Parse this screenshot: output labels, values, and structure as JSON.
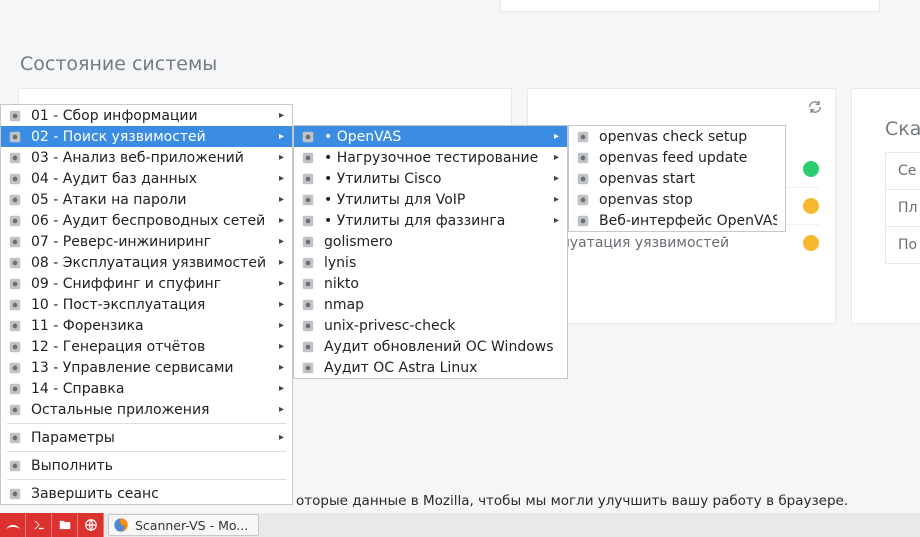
{
  "page": {
    "title": "Состояние системы"
  },
  "status_card": {
    "items": [
      {
        "label": "",
        "color": "green"
      },
      {
        "label": "",
        "color": "amber"
      },
      {
        "label": "сплуатация уязвимостей",
        "color": "amber"
      }
    ]
  },
  "side": {
    "title": "Ска",
    "items": [
      "Се",
      "Пл",
      "По"
    ]
  },
  "menu1": {
    "items": [
      {
        "label": "01 - Сбор информации",
        "arrow": true
      },
      {
        "label": "02 - Поиск уязвимостей",
        "arrow": true,
        "selected": true
      },
      {
        "label": "03 - Анализ веб-приложений",
        "arrow": true
      },
      {
        "label": "04 - Аудит баз данных",
        "arrow": true
      },
      {
        "label": "05 - Атаки на пароли",
        "arrow": true
      },
      {
        "label": "06 - Аудит беспроводных сетей",
        "arrow": true
      },
      {
        "label": "07 - Реверс-инжиниринг",
        "arrow": true
      },
      {
        "label": "08 - Эксплуатация уязвимостей",
        "arrow": true
      },
      {
        "label": "09 - Сниффинг и спуфинг",
        "arrow": true
      },
      {
        "label": "10 - Пост-эксплуатация",
        "arrow": true
      },
      {
        "label": "11 - Форензика",
        "arrow": true
      },
      {
        "label": "12 - Генерация отчётов",
        "arrow": true
      },
      {
        "label": "13 - Управление сервисами",
        "arrow": true
      },
      {
        "label": "14 - Справка",
        "arrow": true
      },
      {
        "label": "Остальные приложения",
        "arrow": true
      }
    ],
    "tail": [
      {
        "label": "Параметры",
        "arrow": true
      },
      {
        "label": "Выполнить",
        "arrow": false
      },
      {
        "label": "Завершить сеанс",
        "arrow": false
      }
    ]
  },
  "menu2": {
    "items": [
      {
        "label": "• OpenVAS",
        "arrow": true,
        "selected": true
      },
      {
        "label": "• Нагрузочное тестирование",
        "arrow": true
      },
      {
        "label": "• Утилиты Cisco",
        "arrow": true
      },
      {
        "label": "• Утилиты для VoIP",
        "arrow": true
      },
      {
        "label": "• Утилиты для фаззинга",
        "arrow": true
      },
      {
        "label": "golismero",
        "arrow": false
      },
      {
        "label": "lynis",
        "arrow": false
      },
      {
        "label": "nikto",
        "arrow": false
      },
      {
        "label": "nmap",
        "arrow": false
      },
      {
        "label": "unix-privesc-check",
        "arrow": false
      },
      {
        "label": "Аудит обновлений ОС Windows",
        "arrow": false
      },
      {
        "label": "Аудит ОС Astra Linux",
        "arrow": false
      }
    ]
  },
  "menu3": {
    "items": [
      {
        "label": "openvas check setup",
        "arrow": false
      },
      {
        "label": "openvas feed update",
        "arrow": false
      },
      {
        "label": "openvas start",
        "arrow": false
      },
      {
        "label": "openvas stop",
        "arrow": false
      },
      {
        "label": "Веб-интерфейс OpenVAS",
        "arrow": false
      }
    ]
  },
  "notice": "оторые данные в Mozilla, чтобы мы могли улучшить вашу работу в браузере.",
  "taskbar": {
    "task_label": "Scanner-VS - Mo..."
  },
  "icons": {
    "arrow": "▸"
  }
}
